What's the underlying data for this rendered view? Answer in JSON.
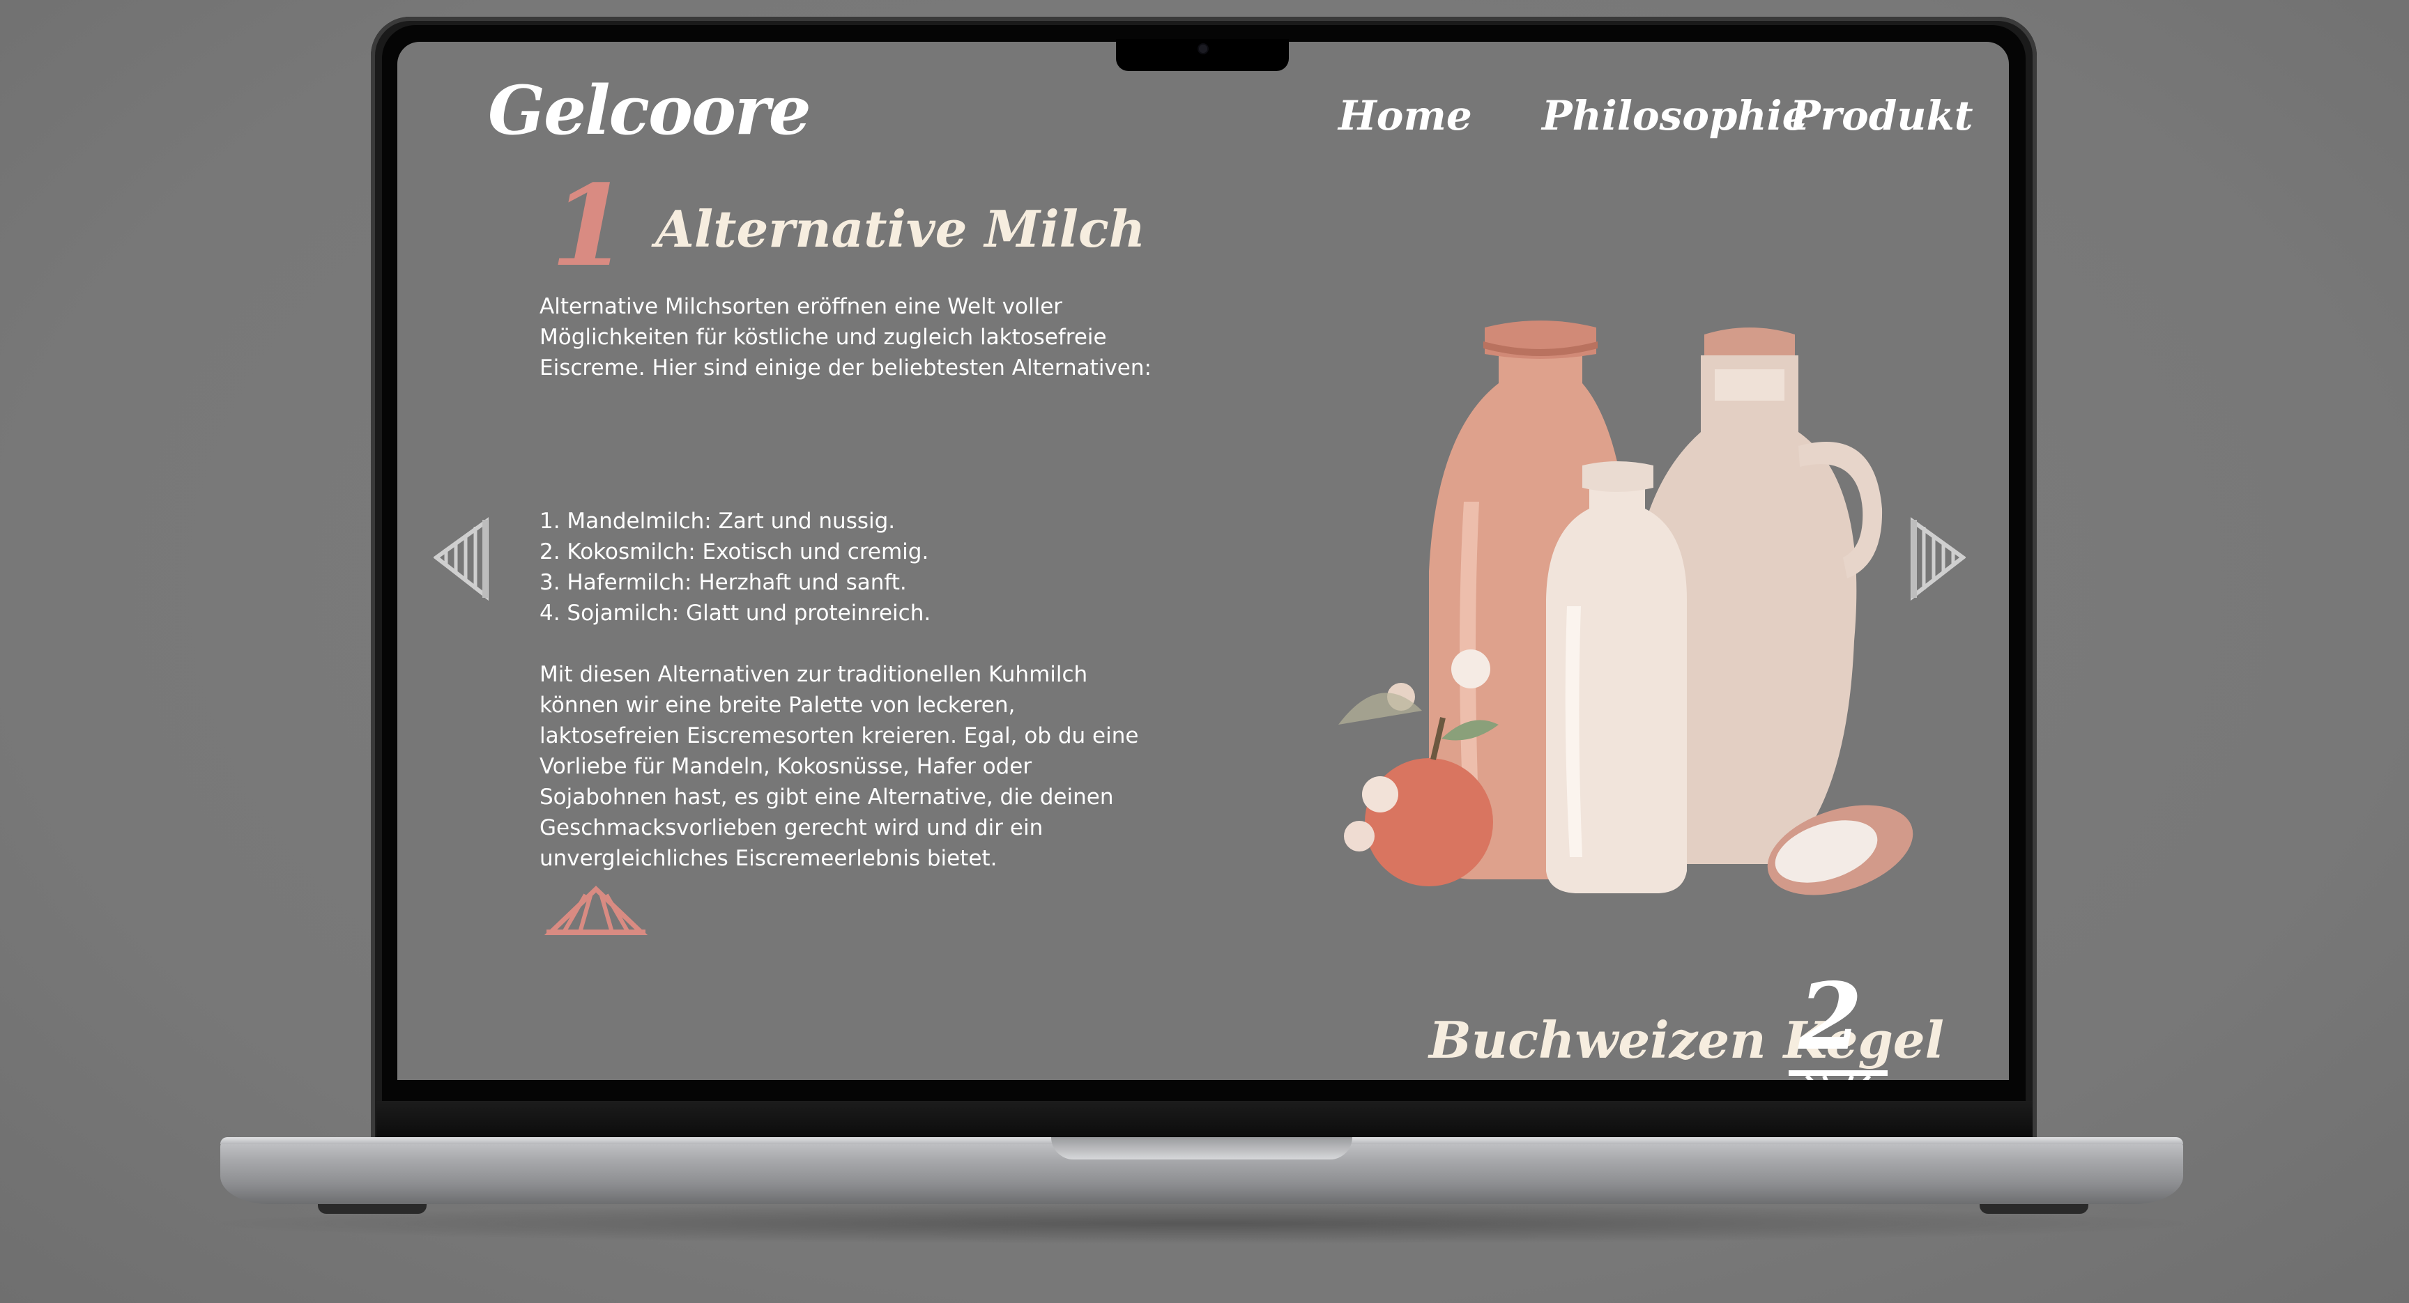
{
  "brand": {
    "logo_text": "Gelcoore"
  },
  "nav": [
    {
      "label": "Home"
    },
    {
      "label": "Philosophie"
    },
    {
      "label": "Produkt"
    }
  ],
  "section": {
    "number": "1",
    "title": "Alternative Milch",
    "intro": "Alternative Milchsorten eröffnen eine Welt voller Möglichkeiten für köstliche und zugleich laktosefreie Eiscreme. Hier sind einige der beliebtesten Alternativen:",
    "list": [
      "1. Mandelmilch: Zart und nussig.",
      "2. Kokosmilch: Exotisch und cremig.",
      "3. Hafermilch: Herzhaft und sanft.",
      "4. Sojamilch: Glatt und proteinreich."
    ],
    "outro": "Mit diesen Alternativen zur traditionellen Kuhmilch können wir eine breite Palette von leckeren, laktosefreien Eiscremesorten kreieren. Egal, ob du eine Vorliebe für Mandeln, Kokosnüsse, Hafer oder Sojabohnen hast, es gibt eine Alternative, die deinen Geschmacksvorlieben gerecht wird und dir ein unvergleichliches Eiscremeerlebnis bietet."
  },
  "next_section": {
    "title": "Buchweizen Kegel",
    "number": "2"
  },
  "icons": {
    "prev": "cone-left-arrow-icon",
    "next": "cone-right-arrow-icon",
    "up": "cone-up-arrow-icon",
    "down": "cone-down-arrow-icon"
  },
  "colors": {
    "screen_bg": "#777777",
    "accent": "#d98b82",
    "text": "#ffffff",
    "title": "#f6eddf"
  }
}
